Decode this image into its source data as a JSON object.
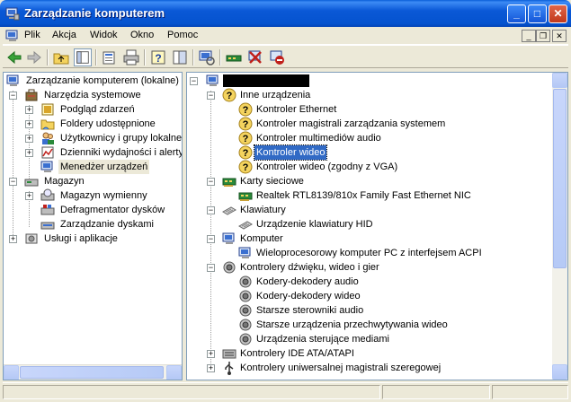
{
  "window": {
    "title": "Zarządzanie komputerem",
    "minimize": "_",
    "maximize": "□",
    "close": "✕"
  },
  "menu": {
    "items": [
      "Plik",
      "Akcja",
      "Widok",
      "Okno",
      "Pomoc"
    ],
    "mdi": [
      "_",
      "❐",
      "✕"
    ]
  },
  "toolbar": {
    "buttons": [
      "back-icon",
      "forward-icon",
      "up-folder-icon",
      "show-tree-icon",
      "properties-icon",
      "print-icon",
      "help-icon",
      "console-tree-icon",
      "scan-hardware-icon",
      "update-driver-icon",
      "disable-device-icon",
      "uninstall-device-icon"
    ]
  },
  "left_tree": {
    "root": "Zarządzanie komputerem (lokalne)",
    "items": [
      {
        "label": "Narzędzia systemowe",
        "level": 1,
        "expander": "−"
      },
      {
        "label": "Podgląd zdarzeń",
        "level": 2,
        "expander": "+"
      },
      {
        "label": "Foldery udostępnione",
        "level": 2,
        "expander": "+"
      },
      {
        "label": "Użytkownicy i grupy lokalne",
        "level": 2,
        "expander": "+"
      },
      {
        "label": "Dzienniki wydajności i alerty",
        "level": 2,
        "expander": "+"
      },
      {
        "label": "Menedżer urządzeń",
        "level": 2,
        "expander": "",
        "selected": true
      },
      {
        "label": "Magazyn",
        "level": 1,
        "expander": "−"
      },
      {
        "label": "Magazyn wymienny",
        "level": 2,
        "expander": "+"
      },
      {
        "label": "Defragmentator dysków",
        "level": 2,
        "expander": ""
      },
      {
        "label": "Zarządzanie dyskami",
        "level": 2,
        "expander": ""
      },
      {
        "label": "Usługi i aplikacje",
        "level": 1,
        "expander": "+"
      }
    ]
  },
  "device_tree": {
    "items": [
      {
        "label": "Inne urządzenia",
        "level": 1,
        "expander": "−",
        "icon": "unknown-device-icon"
      },
      {
        "label": "Kontroler Ethernet",
        "level": 2,
        "icon": "unknown-device-icon"
      },
      {
        "label": "Kontroler magistrali zarządzania systemem",
        "level": 2,
        "icon": "unknown-device-icon"
      },
      {
        "label": "Kontroler multimediów audio",
        "level": 2,
        "icon": "unknown-device-icon"
      },
      {
        "label": "Kontroler wideo",
        "level": 2,
        "icon": "unknown-device-icon",
        "selected": true
      },
      {
        "label": "Kontroler wideo (zgodny z VGA)",
        "level": 2,
        "icon": "unknown-device-icon"
      },
      {
        "label": "Karty sieciowe",
        "level": 1,
        "expander": "−",
        "icon": "network-card-icon"
      },
      {
        "label": "Realtek RTL8139/810x Family Fast Ethernet NIC",
        "level": 2,
        "icon": "network-card-icon"
      },
      {
        "label": "Klawiatury",
        "level": 1,
        "expander": "−",
        "icon": "keyboard-icon"
      },
      {
        "label": "Urządzenie klawiatury HID",
        "level": 2,
        "icon": "keyboard-icon"
      },
      {
        "label": "Komputer",
        "level": 1,
        "expander": "−",
        "icon": "computer-icon"
      },
      {
        "label": "Wieloprocesorowy komputer PC z interfejsem ACPI",
        "level": 2,
        "icon": "computer-icon"
      },
      {
        "label": "Kontrolery dźwięku, wideo i gier",
        "level": 1,
        "expander": "−",
        "icon": "speaker-icon"
      },
      {
        "label": "Kodery-dekodery audio",
        "level": 2,
        "icon": "speaker-icon"
      },
      {
        "label": "Kodery-dekodery wideo",
        "level": 2,
        "icon": "speaker-icon"
      },
      {
        "label": "Starsze sterowniki audio",
        "level": 2,
        "icon": "speaker-icon"
      },
      {
        "label": "Starsze urządzenia przechwytywania wideo",
        "level": 2,
        "icon": "speaker-icon"
      },
      {
        "label": "Urządzenia sterujące mediami",
        "level": 2,
        "icon": "speaker-icon"
      },
      {
        "label": "Kontrolery IDE ATA/ATAPI",
        "level": 1,
        "expander": "+",
        "icon": "ide-controller-icon"
      },
      {
        "label": "Kontrolery uniwersalnej magistrali szeregowej",
        "level": 1,
        "expander": "+",
        "icon": "usb-icon"
      }
    ]
  },
  "colors": {
    "selection": "#316ac5",
    "titlebar": "#0553cf",
    "face": "#ece9d8"
  }
}
